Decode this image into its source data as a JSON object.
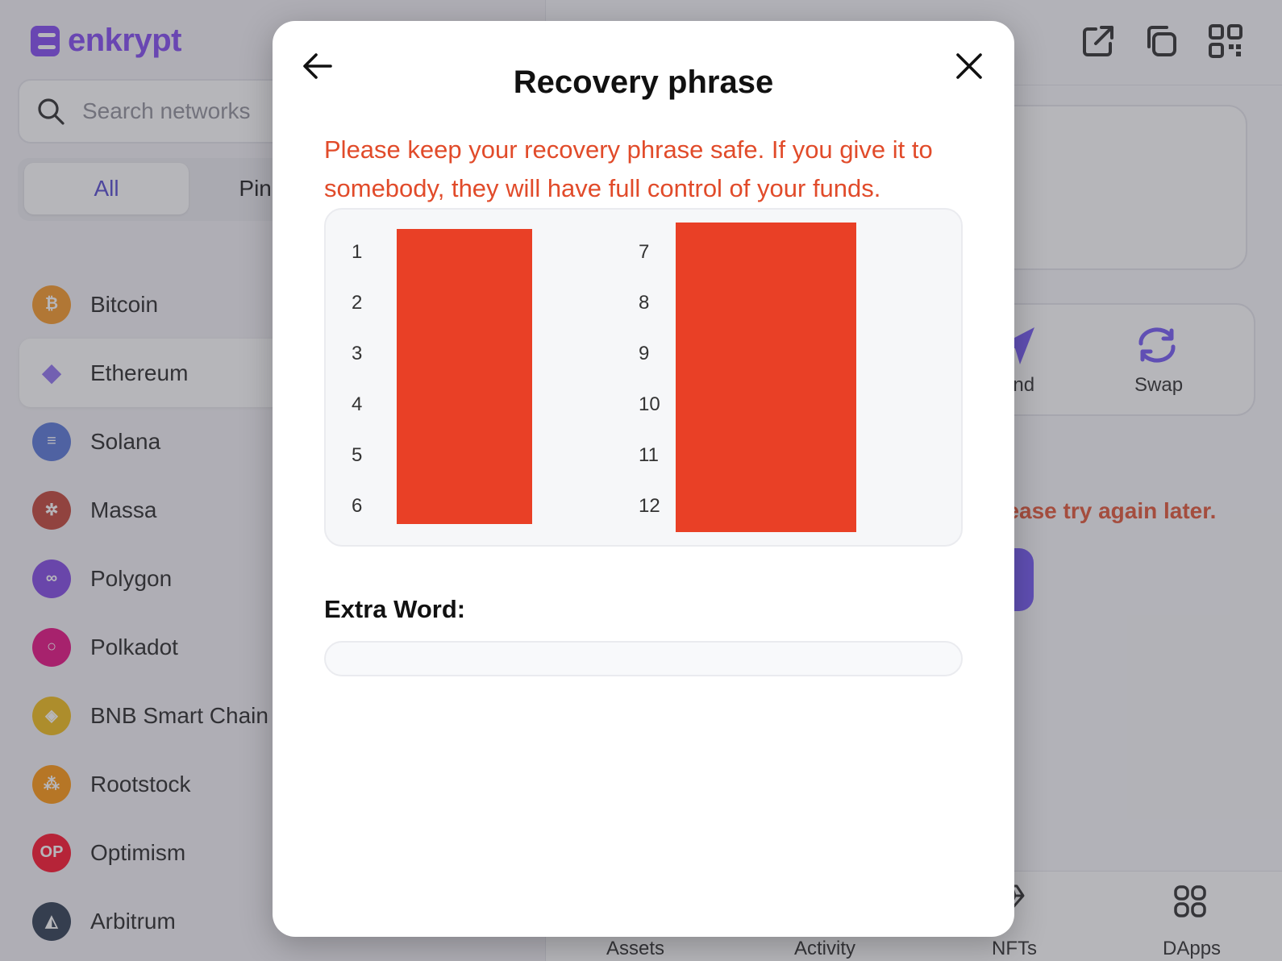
{
  "app": {
    "logo_text": "enkrypt"
  },
  "search": {
    "placeholder": "Search networks"
  },
  "filter_tabs": [
    {
      "label": "All",
      "active": true
    },
    {
      "label": "Pinned",
      "active": false
    }
  ],
  "networks": [
    {
      "name": "Bitcoin",
      "icon": "bitcoin-icon",
      "color": "#f7931a",
      "glyph": "₿"
    },
    {
      "name": "Ethereum",
      "icon": "ethereum-icon",
      "color": "#ffffff",
      "glyph": "◆",
      "selected": true
    },
    {
      "name": "Solana",
      "icon": "solana-icon",
      "color": "#4e6fd6",
      "glyph": "≡"
    },
    {
      "name": "Massa",
      "icon": "massa-icon",
      "color": "#c0392b",
      "glyph": "✲"
    },
    {
      "name": "Polygon",
      "icon": "polygon-icon",
      "color": "#7b3fe4",
      "glyph": "∞"
    },
    {
      "name": "Polkadot",
      "icon": "polkadot-icon",
      "color": "#e6007a",
      "glyph": "○"
    },
    {
      "name": "BNB Smart Chain",
      "icon": "bnb-icon",
      "color": "#f0b90b",
      "glyph": "◈"
    },
    {
      "name": "Rootstock",
      "icon": "rootstock-icon",
      "color": "#ff9100",
      "glyph": "⁂"
    },
    {
      "name": "Optimism",
      "icon": "optimism-icon",
      "color": "#ff0420",
      "glyph": "OP"
    },
    {
      "name": "Arbitrum",
      "icon": "arbitrum-icon",
      "color": "#213147",
      "glyph": "◭"
    }
  ],
  "main": {
    "actions": [
      {
        "label": "Send",
        "icon": "send-icon"
      },
      {
        "label": "Swap",
        "icon": "swap-icon"
      }
    ],
    "error_message": "Please try again later.",
    "bottom_nav": [
      {
        "label": "Assets"
      },
      {
        "label": "Activity"
      },
      {
        "label": "NFTs"
      },
      {
        "label": "DApps"
      }
    ],
    "colors": {
      "accent": "#6b4ef5",
      "error": "#e14b2a"
    }
  },
  "modal": {
    "title": "Recovery phrase",
    "warning": "Please keep your recovery phrase safe. If you give it to somebody, they will have full control of your funds.",
    "word_numbers_left": [
      "1",
      "2",
      "3",
      "4",
      "5",
      "6"
    ],
    "word_numbers_right": [
      "7",
      "8",
      "9",
      "10",
      "11",
      "12"
    ],
    "redaction_color": "#e94026",
    "extra_word_label": "Extra Word:",
    "extra_word_value": ""
  }
}
